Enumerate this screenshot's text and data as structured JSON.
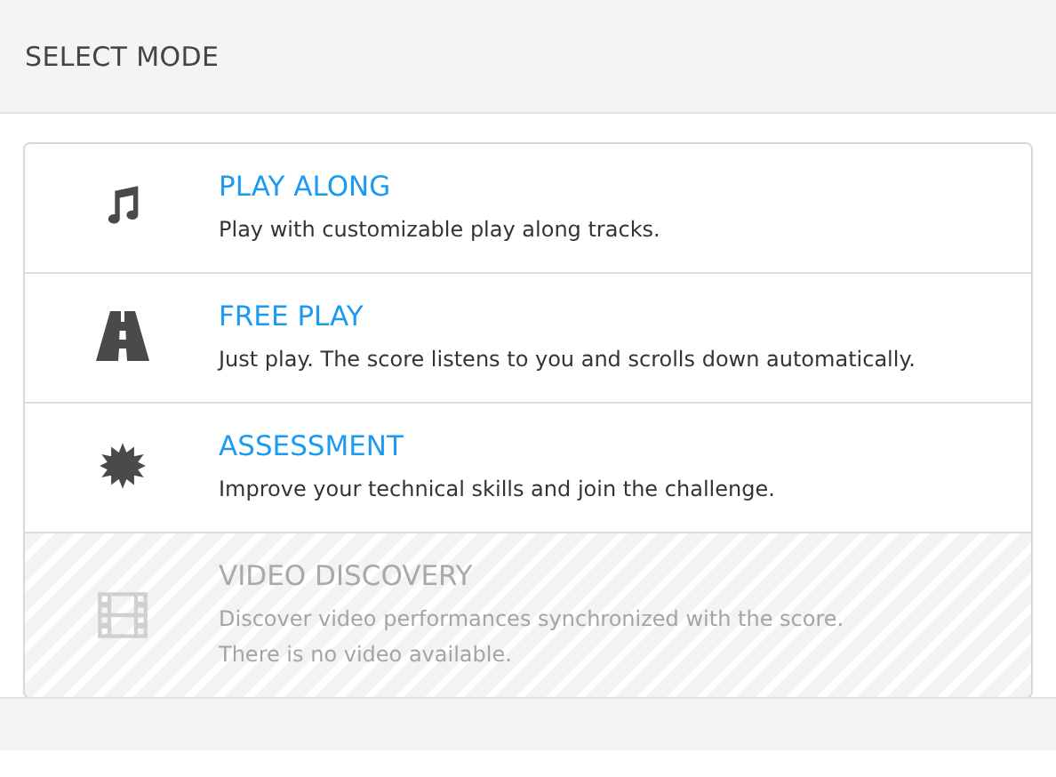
{
  "header": {
    "title": "SELECT MODE"
  },
  "modes": [
    {
      "title": "PLAY ALONG",
      "lines": [
        "Play with customizable play along tracks."
      ],
      "disabled": false
    },
    {
      "title": "FREE PLAY",
      "lines": [
        "Just play. The score listens to you and scrolls down automatically."
      ],
      "disabled": false
    },
    {
      "title": "ASSESSMENT",
      "lines": [
        "Improve your technical skills and join the challenge."
      ],
      "disabled": false
    },
    {
      "title": "VIDEO DISCOVERY",
      "lines": [
        "Discover video performances synchronized with the score.",
        "There is no video available."
      ],
      "disabled": true
    }
  ]
}
